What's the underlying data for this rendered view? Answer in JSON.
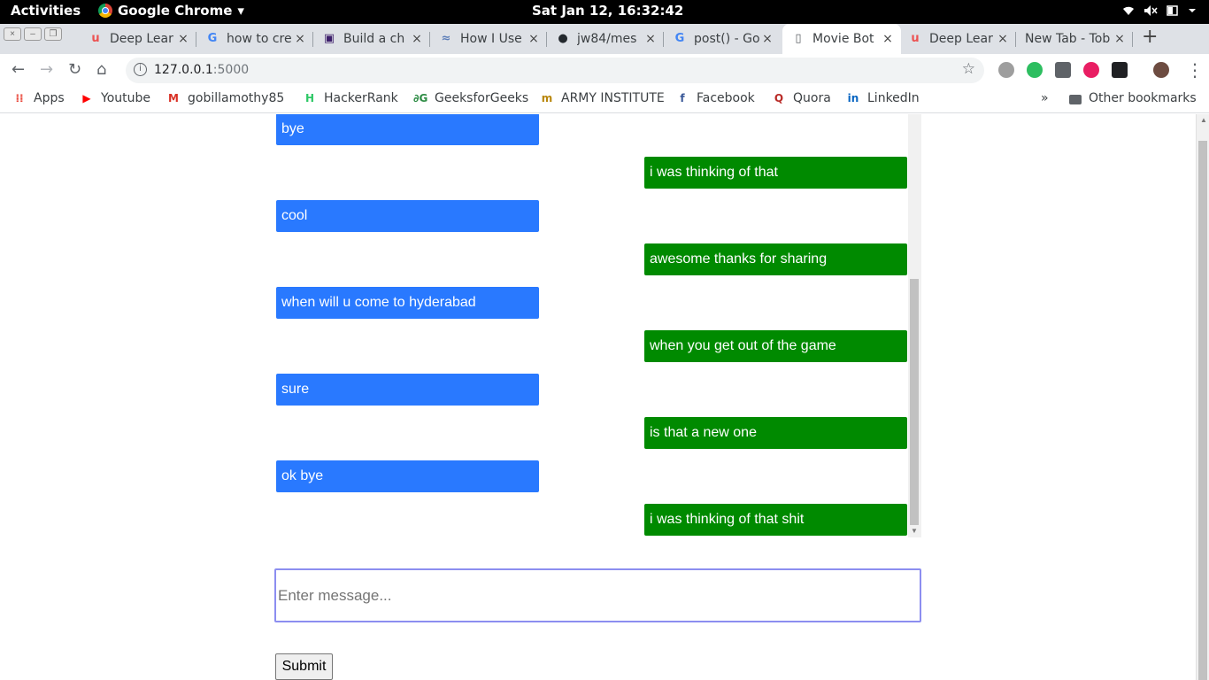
{
  "topbar": {
    "activities": "Activities",
    "app_name": "Google Chrome",
    "app_menu_arrow": "▾",
    "clock": "Sat Jan 12, 16:32:42",
    "tray_icons": [
      "wifi-icon",
      "volume-muted-icon",
      "battery-icon",
      "power-menu-icon"
    ]
  },
  "tabs": [
    {
      "title": "Deep Lear",
      "icon": "udemy-icon",
      "icon_glyph": "u",
      "icon_color": "#ec5252"
    },
    {
      "title": "how to cre",
      "icon": "google-icon",
      "icon_glyph": "G",
      "icon_color": "#4285f4"
    },
    {
      "title": "Build a ch",
      "icon": "site-icon",
      "icon_glyph": "▣",
      "icon_color": "#3d1f6b"
    },
    {
      "title": "How I Use",
      "icon": "site-icon",
      "icon_glyph": "≈",
      "icon_color": "#5b7db8"
    },
    {
      "title": "jw84/mes",
      "icon": "github-icon",
      "icon_glyph": "●",
      "icon_color": "#24292e"
    },
    {
      "title": "post() - Go",
      "icon": "google-icon",
      "icon_glyph": "G",
      "icon_color": "#4285f4"
    },
    {
      "title": "Movie Bot",
      "icon": "document-icon",
      "icon_glyph": "▯",
      "icon_color": "#5f6368"
    },
    {
      "title": "Deep Lear",
      "icon": "udemy-icon",
      "icon_glyph": "u",
      "icon_color": "#ec5252"
    },
    {
      "title": "New Tab - Tob",
      "icon": "",
      "icon_glyph": "",
      "icon_color": "#5f6368"
    }
  ],
  "active_tab_index": 6,
  "close_glyph": "×",
  "new_tab_glyph": "+",
  "toolbar": {
    "back": "←",
    "forward": "→",
    "reload": "↻",
    "home": "⌂",
    "url_host": "127.0.0.1",
    "url_port": ":5000",
    "info_glyph": "i",
    "star": "☆",
    "menu": "⋮"
  },
  "bookmarks": [
    {
      "label": "Apps",
      "icon": "apps-grid-icon",
      "glyph": "⁞⁞",
      "color": "#e94235"
    },
    {
      "label": "Youtube",
      "icon": "youtube-icon",
      "glyph": "▶",
      "color": "#ff0000"
    },
    {
      "label": "gobillamothy85",
      "icon": "gmail-icon",
      "glyph": "M",
      "color": "#d93025"
    },
    {
      "label": "HackerRank",
      "icon": "hackerrank-icon",
      "glyph": "H",
      "color": "#2ec866"
    },
    {
      "label": "GeeksforGeeks",
      "icon": "geeksforgeeks-icon",
      "glyph": "∂G",
      "color": "#2f8d46"
    },
    {
      "label": "ARMY INSTITUTE",
      "icon": "institute-icon",
      "glyph": "m",
      "color": "#b8860b"
    },
    {
      "label": "Facebook",
      "icon": "facebook-icon",
      "glyph": "f",
      "color": "#3b5998"
    },
    {
      "label": "Quora",
      "icon": "quora-icon",
      "glyph": "Q",
      "color": "#b92b27"
    },
    {
      "label": "LinkedIn",
      "icon": "linkedin-icon",
      "glyph": "in",
      "color": "#0a66c2"
    }
  ],
  "bookmarks_overflow": "»",
  "other_bookmarks": "Other bookmarks",
  "chat": {
    "messages": [
      {
        "sender": "user",
        "text": "bye"
      },
      {
        "sender": "bot",
        "text": "i was thinking of that"
      },
      {
        "sender": "user",
        "text": "cool"
      },
      {
        "sender": "bot",
        "text": "awesome thanks for sharing"
      },
      {
        "sender": "user",
        "text": "when will u come to hyderabad"
      },
      {
        "sender": "bot",
        "text": "when you get out of the game"
      },
      {
        "sender": "user",
        "text": "sure"
      },
      {
        "sender": "bot",
        "text": "is that a new one"
      },
      {
        "sender": "user",
        "text": "ok bye"
      },
      {
        "sender": "bot",
        "text": "i was thinking of that shit"
      }
    ],
    "colors": {
      "user": "#2979ff",
      "bot": "#008a00"
    }
  },
  "form": {
    "input_placeholder": "Enter message...",
    "input_value": "",
    "submit_label": "Submit"
  }
}
